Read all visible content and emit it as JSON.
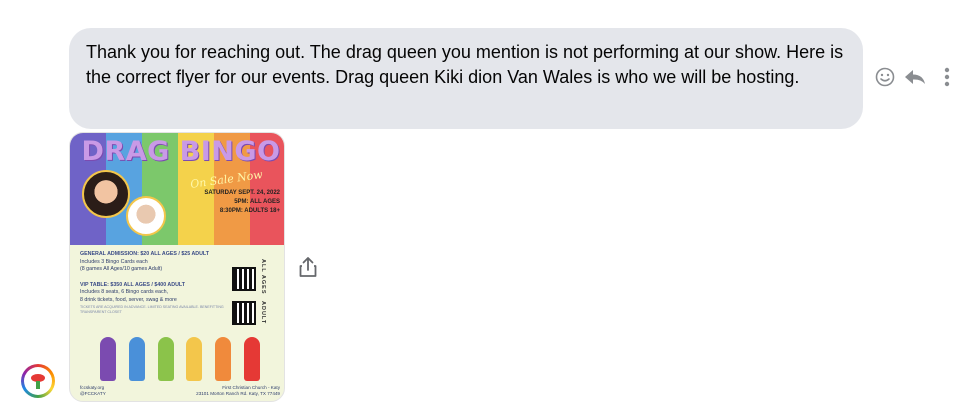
{
  "message": {
    "text": "Thank you for reaching out. The drag queen you mention is not performing at our show. Here is the correct flyer for our events.  Drag queen Kiki dion Van Wales is who we will be hosting."
  },
  "actions": [
    "emoji-react",
    "reply",
    "more-options"
  ],
  "flyer": {
    "title": "DRAG BINGO",
    "on_sale": "On Sale Now",
    "date_lines": [
      "SATURDAY SEPT. 24, 2022",
      "5PM: ALL AGES",
      "8:30PM: ADULTS 18+"
    ],
    "general_heading": "GENERAL ADMISSION: $20 ALL AGES / $25 ADULT",
    "general_lines": [
      "Includes 3 Bingo Cards each",
      "(8 games All Ages/10 games Adult)"
    ],
    "vip_heading": "VIP TABLE: $350 ALL AGES / $400 ADULT",
    "vip_lines": [
      "Includes 8 seats, 6 Bingo cards each,",
      "8 drink tickets, food, server, swag & more"
    ],
    "note": "TICKETS ARE ACQUIRED IN ADVANCE. LIMITED SEATING AVAILABLE. BENEFITTING TRANSPARENT CLOSET",
    "side_all_ages": "ALL AGES",
    "side_adult": "ADULT",
    "footer_left": [
      "fccskaty.org",
      "@FCCKATY"
    ],
    "footer_right": [
      "First Christian Church - Katy",
      "23101 Morton Ranch Rd. Katy, TX 77449"
    ],
    "stripe_colors": [
      "#6f63c7",
      "#58a3e0",
      "#7cc86b",
      "#f4d24b",
      "#f09a45",
      "#e9545c"
    ],
    "queen_colors": [
      "#7b4bb0",
      "#4a90d9",
      "#8bc34a",
      "#f3c64b",
      "#f08a3c",
      "#e53935"
    ]
  }
}
